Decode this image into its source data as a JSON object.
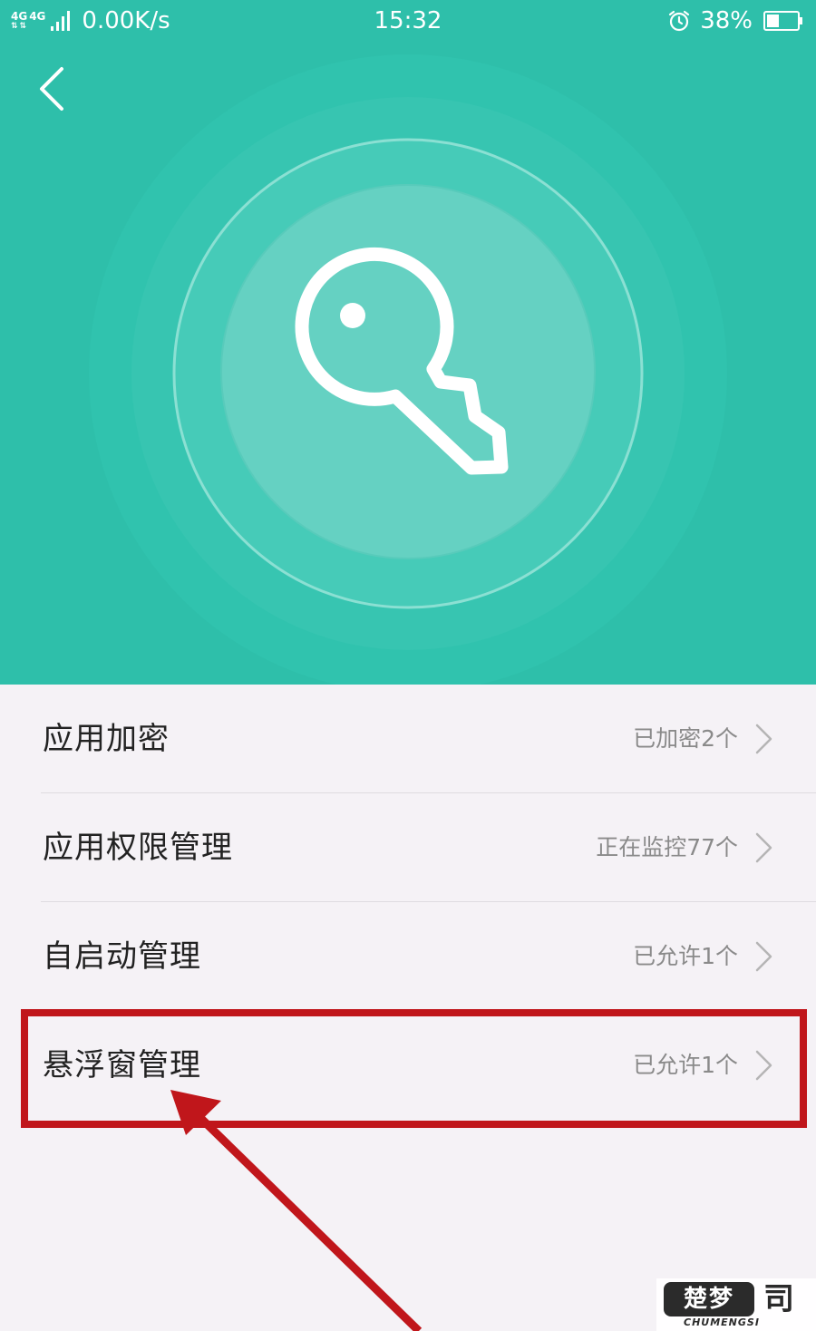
{
  "status_bar": {
    "network_a": "4G",
    "network_b": "4G",
    "speed": "0.00K/s",
    "time": "15:32",
    "battery": "38%"
  },
  "colors": {
    "header_bg": "#2ebfaa",
    "list_bg": "#f5f2f6",
    "annotation": "#c0161b"
  },
  "icons": {
    "hero": "key-icon",
    "back": "back-arrow-icon",
    "row_action": "chevron-right-icon"
  },
  "settings": {
    "items": [
      {
        "title": "应用加密",
        "value": "已加密2个"
      },
      {
        "title": "应用权限管理",
        "value": "正在监控77个"
      },
      {
        "title": "自启动管理",
        "value": "已允许1个"
      },
      {
        "title": "悬浮窗管理",
        "value": "已允许1个"
      }
    ]
  },
  "watermark": {
    "brand": "楚梦",
    "brand_mark": "司",
    "brand_latin": "CHUMENGSI"
  }
}
